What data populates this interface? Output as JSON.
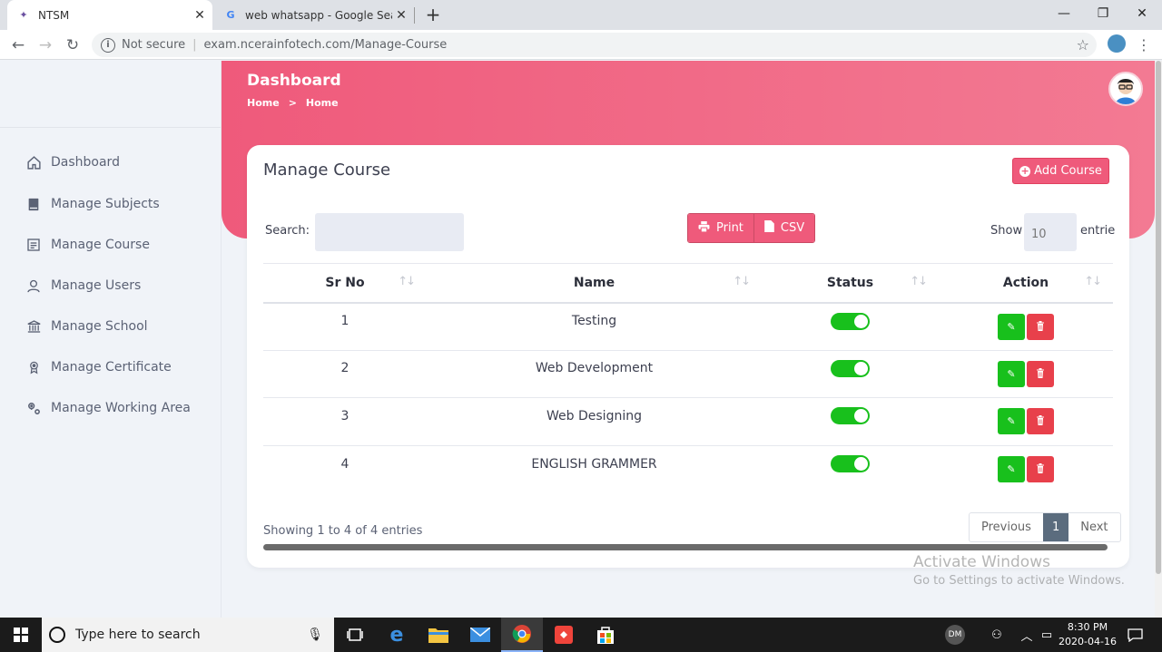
{
  "browser": {
    "tabs": [
      {
        "title": "NTSM",
        "favicon": "ntsm-favicon"
      },
      {
        "title": "web whatsapp - Google Search",
        "favicon": "google-favicon"
      }
    ],
    "address": {
      "security": "Not secure",
      "url": "exam.ncerainfotech.com/Manage-Course"
    }
  },
  "sidebar": {
    "items": [
      {
        "label": "Dashboard",
        "icon": "home-icon"
      },
      {
        "label": "Manage Subjects",
        "icon": "book-icon"
      },
      {
        "label": "Manage Course",
        "icon": "list-icon"
      },
      {
        "label": "Manage Users",
        "icon": "user-icon"
      },
      {
        "label": "Manage School",
        "icon": "school-icon"
      },
      {
        "label": "Manage Certificate",
        "icon": "award-icon"
      },
      {
        "label": "Manage Working Area",
        "icon": "location-icon"
      }
    ]
  },
  "header": {
    "title": "Dashboard",
    "breadcrumb": [
      "Home",
      ">",
      "Home"
    ]
  },
  "card": {
    "title": "Manage Course",
    "add_button": "Add Course",
    "search_label": "Search:",
    "print_label": "Print",
    "csv_label": "CSV",
    "show_label": "Show",
    "show_value": "10",
    "entries_label": "entrie",
    "columns": [
      "Sr No",
      "Name",
      "Status",
      "Action"
    ],
    "rows": [
      {
        "sr": "1",
        "name": "Testing",
        "status": "on"
      },
      {
        "sr": "2",
        "name": "Web Development",
        "status": "on"
      },
      {
        "sr": "3",
        "name": "Web Designing",
        "status": "on"
      },
      {
        "sr": "4",
        "name": "ENGLISH GRAMMER",
        "status": "on"
      }
    ],
    "footer_info": "Showing 1 to 4 of 4 entries",
    "pager": {
      "previous": "Previous",
      "current": "1",
      "next": "Next"
    }
  },
  "watermark": {
    "line1": "Activate Windows",
    "line2": "Go to Settings to activate Windows."
  },
  "taskbar": {
    "search_placeholder": "Type here to search",
    "user_initials": "DM",
    "time": "8:30 PM",
    "date": "2020-04-16"
  },
  "colors": {
    "accent": "#ef5a7b",
    "toggle_on": "#18c01c",
    "delete": "#e8404b"
  }
}
